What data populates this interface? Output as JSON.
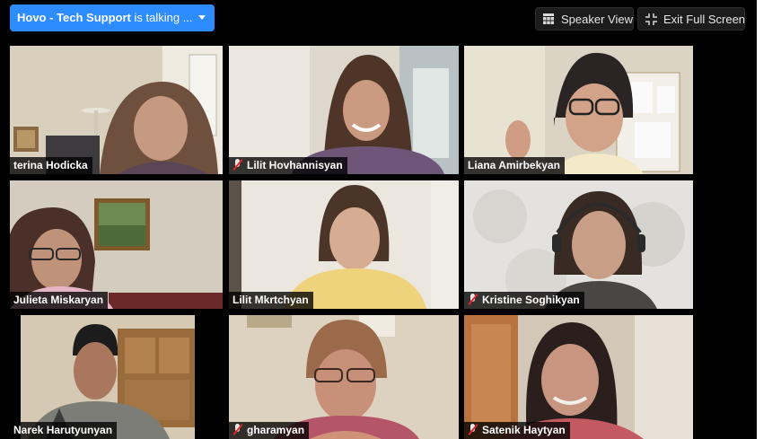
{
  "speaking_indicator": {
    "name": "Hovo - Tech Support",
    "suffix": " is talking ..."
  },
  "controls": {
    "speaker_view_label": "Speaker View",
    "exit_full_screen_label": "Exit Full Screen"
  },
  "participants": [
    {
      "name": "terina Hodicka",
      "muted": false
    },
    {
      "name": "Lilit Hovhannisyan",
      "muted": true
    },
    {
      "name": "Liana Amirbekyan",
      "muted": false
    },
    {
      "name": "Julieta Miskaryan",
      "muted": false
    },
    {
      "name": "Lilit Mkrtchyan",
      "muted": false
    },
    {
      "name": "Kristine Soghikyan",
      "muted": true
    },
    {
      "name": "Narek Harutyunyan",
      "muted": false
    },
    {
      "name": "gharamyan",
      "muted": true
    },
    {
      "name": "Satenik Haytyan",
      "muted": true
    }
  ],
  "colors": {
    "accent": "#2d8cff",
    "background": "#000000",
    "mute_red": "#e02828"
  }
}
